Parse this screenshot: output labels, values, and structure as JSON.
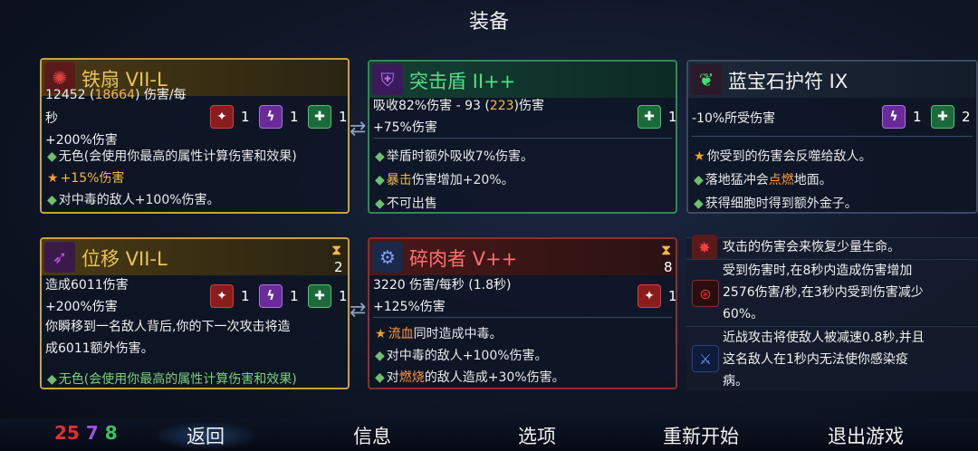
{
  "header": {
    "title": "装备"
  },
  "cards": {
    "tieshan": {
      "name": "铁扇 VII-L",
      "dmg_a": "12452 (",
      "dmg_b": "18664",
      "dmg_c": ") 伤害/每",
      "dmg_d": "秒",
      "bonus": "+200%伤害",
      "scrolls": [
        "1",
        "1",
        "1"
      ],
      "b1": "无色(会使用你最高的属性计算伤害和效果)",
      "b2": "+15%伤害",
      "b3": "对中毒的敌人+100%伤害。"
    },
    "tujidun": {
      "name": "突击盾 II++",
      "stat_a": "吸收82%伤害 - 93 (",
      "stat_b": "223",
      "stat_c": ")伤害",
      "bonus": "+75%伤害",
      "scroll": "1",
      "b1": "举盾时额外吸收7%伤害。",
      "b2a": "暴击",
      "b2b": "伤害增加+20%。",
      "b3": "不可出售"
    },
    "lanbao": {
      "name": "蓝宝石护符 IX",
      "stat": "-10%所受伤害",
      "scrolls": [
        "1",
        "2"
      ],
      "b1": "你受到的伤害会反噬给敌人。",
      "b2a": "落地猛冲会",
      "b2b": "点燃",
      "b2c": "地面。",
      "b3": "获得细胞时得到额外金子。"
    },
    "weiyi": {
      "name": "位移 VII-L",
      "charges": "2",
      "dmg": "造成6011伤害",
      "bonus": "+200%伤害",
      "scrolls": [
        "1",
        "1",
        "1"
      ],
      "desc1": "你瞬移到一名敌人背后,你的下一次攻击将造",
      "desc2": "成6011额外伤害。",
      "b1": "无色(会使用你最高的属性计算伤害和效果)"
    },
    "suirou": {
      "name": "碎肉者 V++",
      "charges": "8",
      "dmg": "3220 伤害/每秒 (1.8秒)",
      "bonus": "+125%伤害",
      "scroll": "1",
      "b1a": "流血",
      "b1b": "同时造成中毒。",
      "b2": "对中毒的敌人+100%伤害。",
      "b3a": "对",
      "b3b": "燃烧",
      "b3c": "的敌人造成+30%伤害。"
    }
  },
  "mutations": {
    "m0": "攻击的伤害会来恢复少量生命。",
    "m1a": "受到伤害时,在8秒内造成伤害增加",
    "m1b": "2576伤害/秒,在3秒内受到伤害减少",
    "m1c": "60%。",
    "m2a": "近战攻击将使敌人被减速0.8秒,并且",
    "m2b": "这名敌人在1秒内无法使你感染疫",
    "m2c": "病。"
  },
  "stats": {
    "brutality": "25",
    "tactics": "7",
    "survival": "8"
  },
  "colors": {
    "brutality": "#e03030",
    "tactics": "#a050e0",
    "survival": "#40c060"
  },
  "nav": {
    "back": "返回",
    "info": "信息",
    "options": "选项",
    "restart": "重新开始",
    "quit": "退出游戏"
  }
}
